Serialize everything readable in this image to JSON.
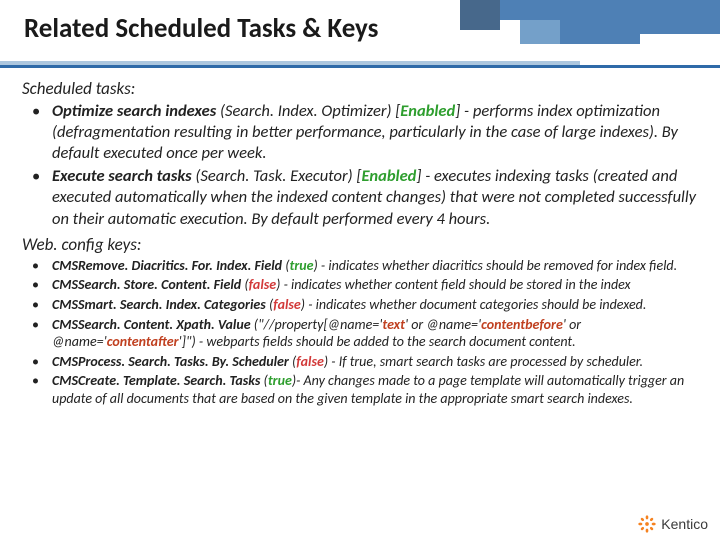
{
  "title": "Related Scheduled Tasks & Keys",
  "sections": {
    "tasks_label": "Scheduled tasks:",
    "keys_label": "Web. config keys:"
  },
  "tasks": [
    {
      "name": "Optimize search indexes",
      "class": "(Search. Index. Optimizer)",
      "status": "Enabled",
      "desc": " - performs index optimization (defragmentation resulting in better performance, particularly in the case of large indexes). By default executed once per week."
    },
    {
      "name": "Execute search tasks",
      "class": "(Search. Task. Executor)",
      "status": "Enabled",
      "desc": " - executes indexing tasks (created and executed automatically when the indexed content changes) that were not completed successfully on their automatic execution. By default performed every 4 hours."
    }
  ],
  "keys": [
    {
      "key": "CMSRemove. Diacritics. For. Index. Field",
      "val": "true",
      "valtype": "green",
      "desc": " - indicates whether diacritics should be removed for index field."
    },
    {
      "key": "CMSSearch. Store. Content. Field",
      "val": "false",
      "valtype": "red",
      "desc": " - indicates whether content field should be stored in the index"
    },
    {
      "key": "CMSSmart. Search. Index. Categories",
      "val": "false",
      "valtype": "red",
      "desc": " - indicates whether document categories should be indexed."
    },
    {
      "key": "CMSSearch. Content. Xpath. Value",
      "val": "\"//property[@name='text' or @name='contentbefore' or @name='contentafter']\"",
      "valtype": "plain",
      "accents": [
        "text",
        "contentbefore",
        "contentafter"
      ],
      "desc": " - webparts fields should be added to the search document content."
    },
    {
      "key": "CMSProcess. Search. Tasks. By. Scheduler",
      "val": "false",
      "valtype": "red",
      "desc": " - If true, smart search tasks are processed by scheduler."
    },
    {
      "key": "CMSCreate. Template. Search. Tasks",
      "val": "true",
      "valtype": "green",
      "desc": "- Any changes made to a page template will automatically trigger an update of all documents that are based on the given template in the appropriate smart search indexes."
    }
  ],
  "brand": "Kentico"
}
